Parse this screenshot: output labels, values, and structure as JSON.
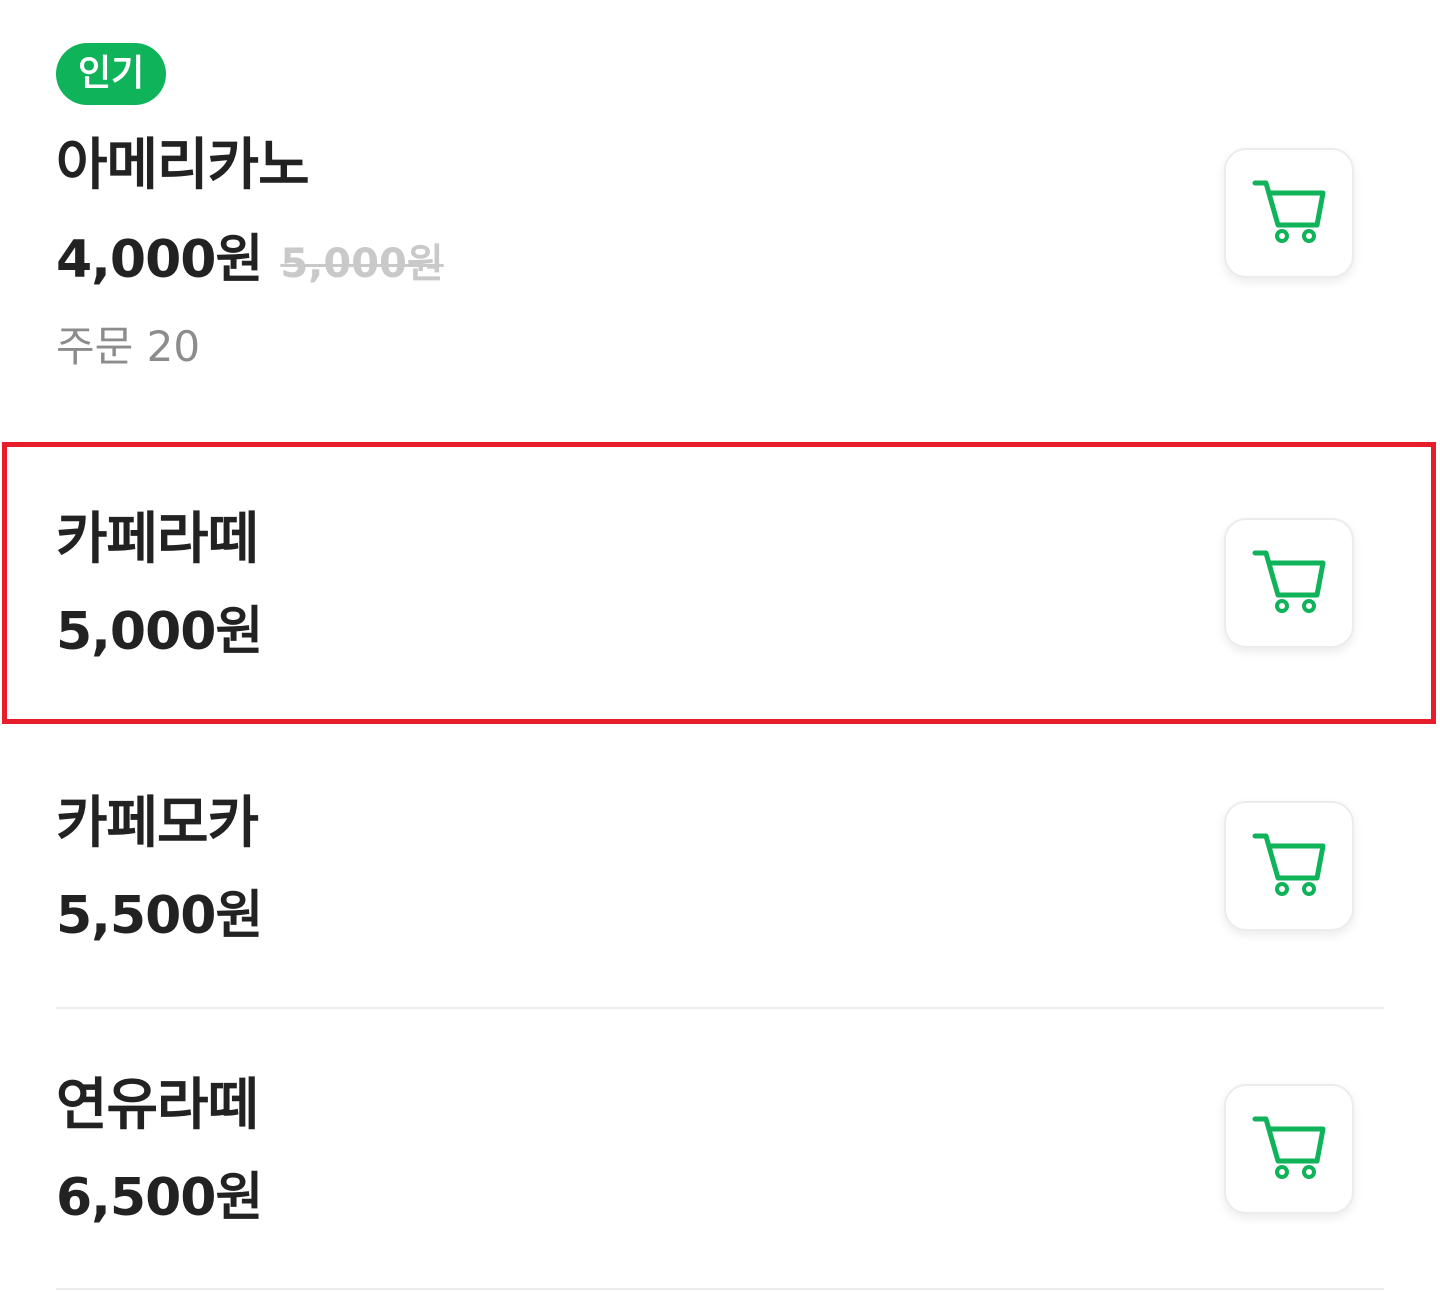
{
  "colors": {
    "accent_green": "#0fb35a",
    "highlight_red": "#e61e2b",
    "text_primary": "#222222",
    "text_muted": "#8c8c8c",
    "strikethrough_gray": "#c9c9c9"
  },
  "menu": {
    "items": [
      {
        "badge": "인기",
        "name": "아메리카노",
        "price": "4,000원",
        "original_price": "5,000원",
        "orders": "주문 20",
        "cart_icon": "cart-icon"
      },
      {
        "name": "카페라떼",
        "price": "5,000원",
        "cart_icon": "cart-icon",
        "highlighted": true
      },
      {
        "name": "카페모카",
        "price": "5,500원",
        "cart_icon": "cart-icon"
      },
      {
        "name": "연유라떼",
        "price": "6,500원",
        "cart_icon": "cart-icon"
      }
    ]
  }
}
